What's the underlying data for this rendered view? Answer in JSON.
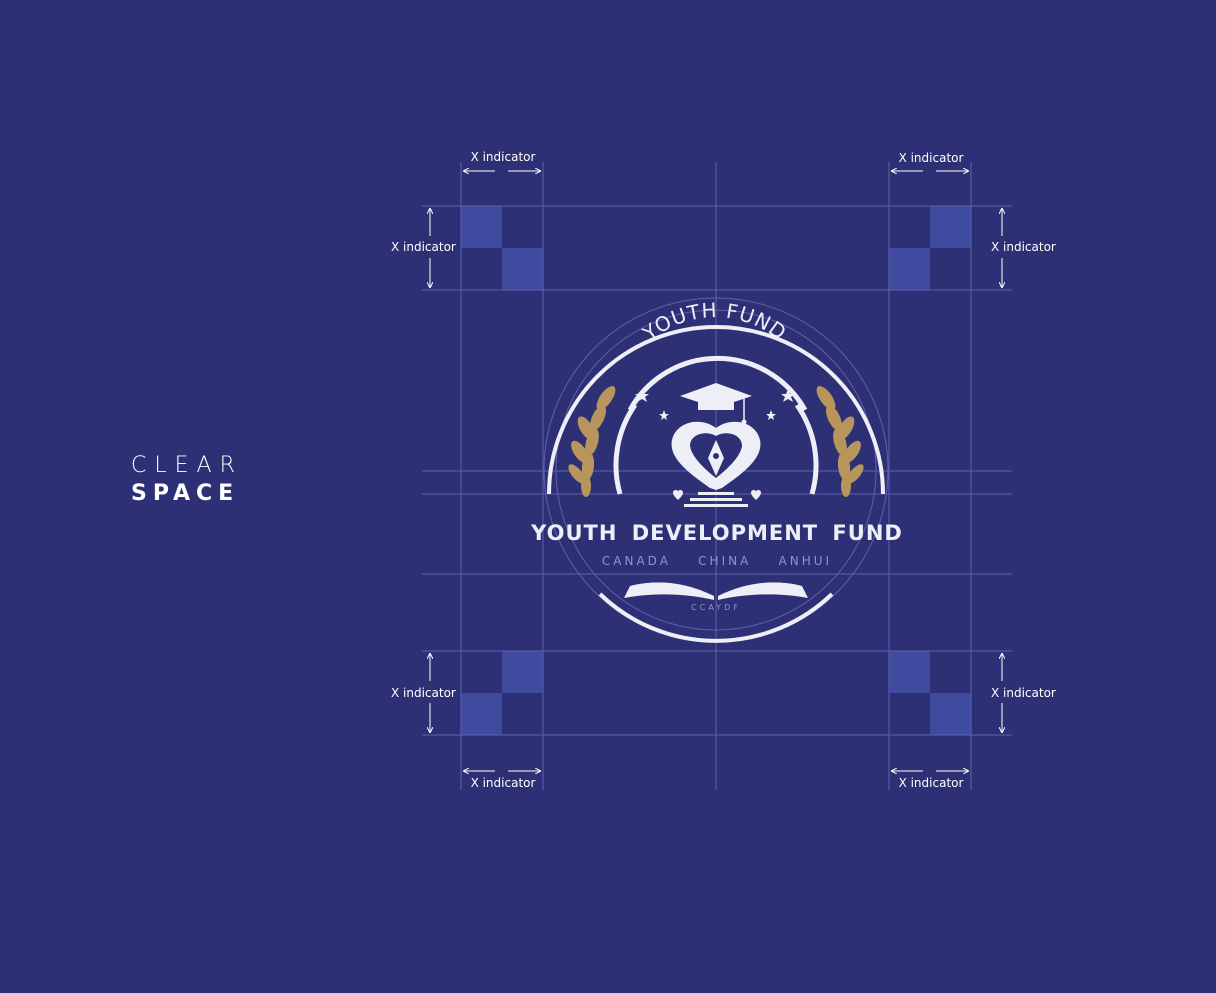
{
  "heading": {
    "line1": "CLEAR",
    "line2": "SPACE"
  },
  "indicator_label": "X indicator",
  "logo": {
    "arc_text": "YOUTH FUND",
    "main_text": "YOUTH DEVELOPMENT FUND",
    "sub_text": "CANADA    CHINA    ANHUI",
    "small_text": "CCAYDF"
  },
  "colors": {
    "background": "#2e3075",
    "guide_square": "#3e4b9e",
    "guide_line": "#5a62ad",
    "logo_white": "#eeeef6",
    "laurel_gold": "#b8955a"
  }
}
